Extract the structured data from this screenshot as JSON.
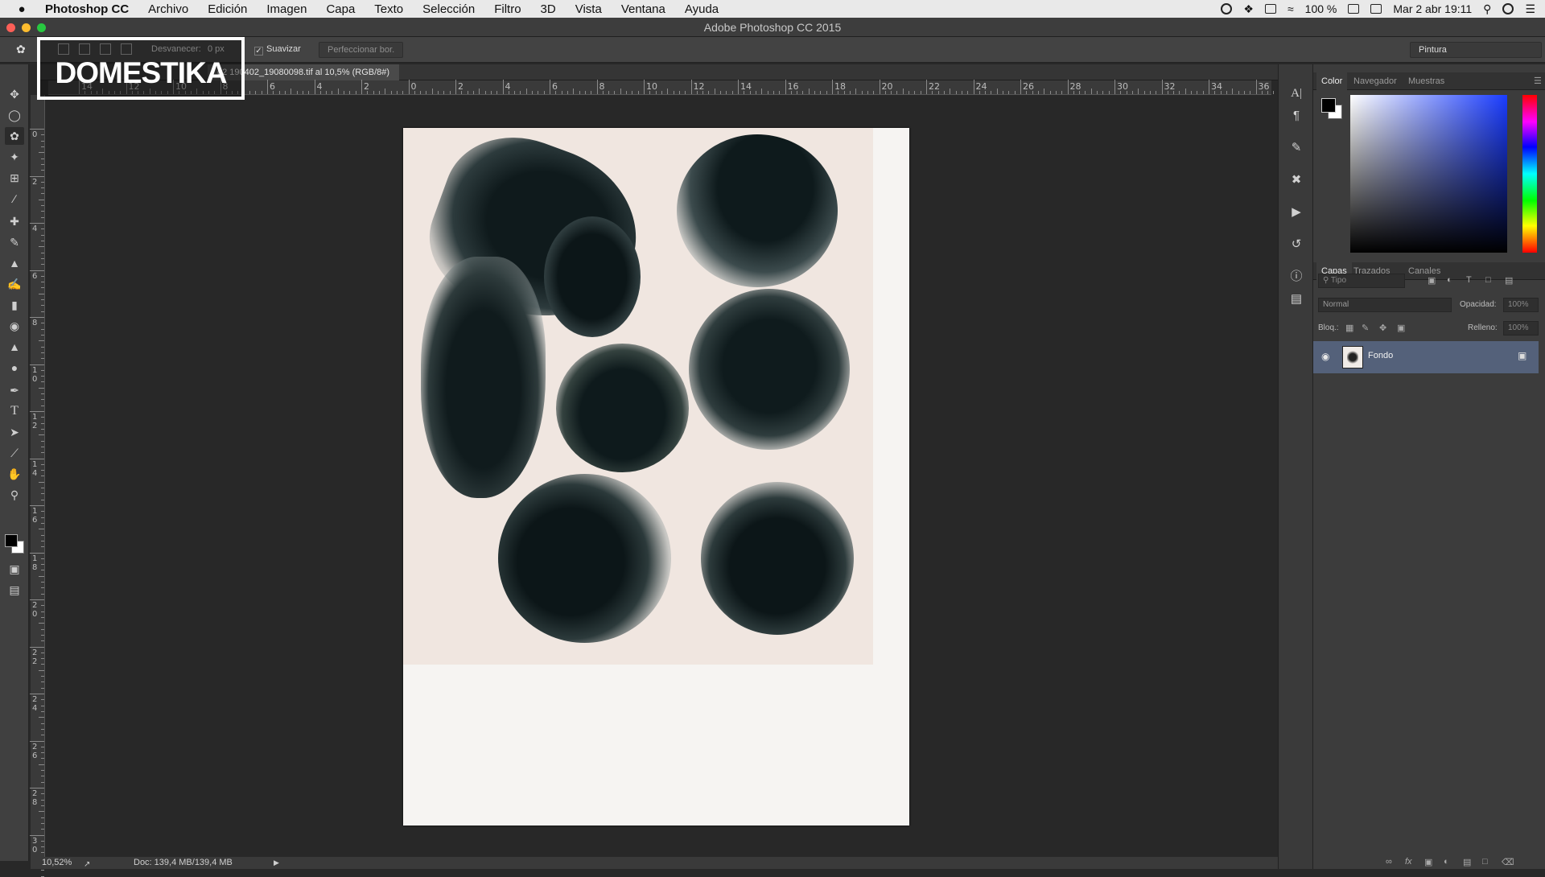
{
  "menubar": {
    "apple": "",
    "items": [
      "Photoshop CC",
      "Archivo",
      "Edición",
      "Imagen",
      "Capa",
      "Texto",
      "Selección",
      "Filtro",
      "3D",
      "Vista",
      "Ventana",
      "Ayuda"
    ],
    "battery": "100 %",
    "datetime": "Mar 2 abr  19:11"
  },
  "window": {
    "title": "Adobe Photoshop CC 2015"
  },
  "options": {
    "feather_label": "Desvanecer:",
    "feather_value": "0 px",
    "antialias_label": "Suavizar",
    "refine_edge": "Perfeccionar bor.",
    "workspace": "Pintura"
  },
  "document": {
    "tab_title": "g2 190402_19080098.tif al 10,5% (RGB/8#)"
  },
  "watermark": {
    "text": "DOMESTIKA"
  },
  "rulers": {
    "h_labels": [
      "14",
      "12",
      "10",
      "8",
      "6",
      "4",
      "2",
      "0",
      "2",
      "4",
      "6",
      "8",
      "10",
      "12",
      "14",
      "16",
      "18",
      "20",
      "22",
      "24",
      "26",
      "28",
      "30",
      "32",
      "34",
      "36"
    ],
    "v_labels": [
      "0",
      "2",
      "4",
      "6",
      "8",
      "1 0",
      "1 2",
      "1 4",
      "1 6",
      "1 8",
      "2 0",
      "2 2",
      "2 4",
      "2 6",
      "2 8",
      "3 0"
    ]
  },
  "status": {
    "zoom": "10,52%",
    "doc": "Doc: 139,4 MB/139,4 MB"
  },
  "color_panel": {
    "tabs": [
      "Color",
      "Navegador",
      "Muestras"
    ],
    "foreground": "#000000",
    "background": "#ffffff"
  },
  "layers_panel": {
    "tabs": [
      "Capas",
      "Trazados",
      "Canales"
    ],
    "filter_placeholder": "Tipo",
    "blend_mode": "Normal",
    "opacity_label": "Opacidad:",
    "opacity_value": "100%",
    "lock_label": "Bloq.:",
    "fill_label": "Relleno:",
    "fill_value": "100%",
    "layers": [
      {
        "name": "Fondo",
        "locked": true,
        "visible": true
      }
    ]
  }
}
